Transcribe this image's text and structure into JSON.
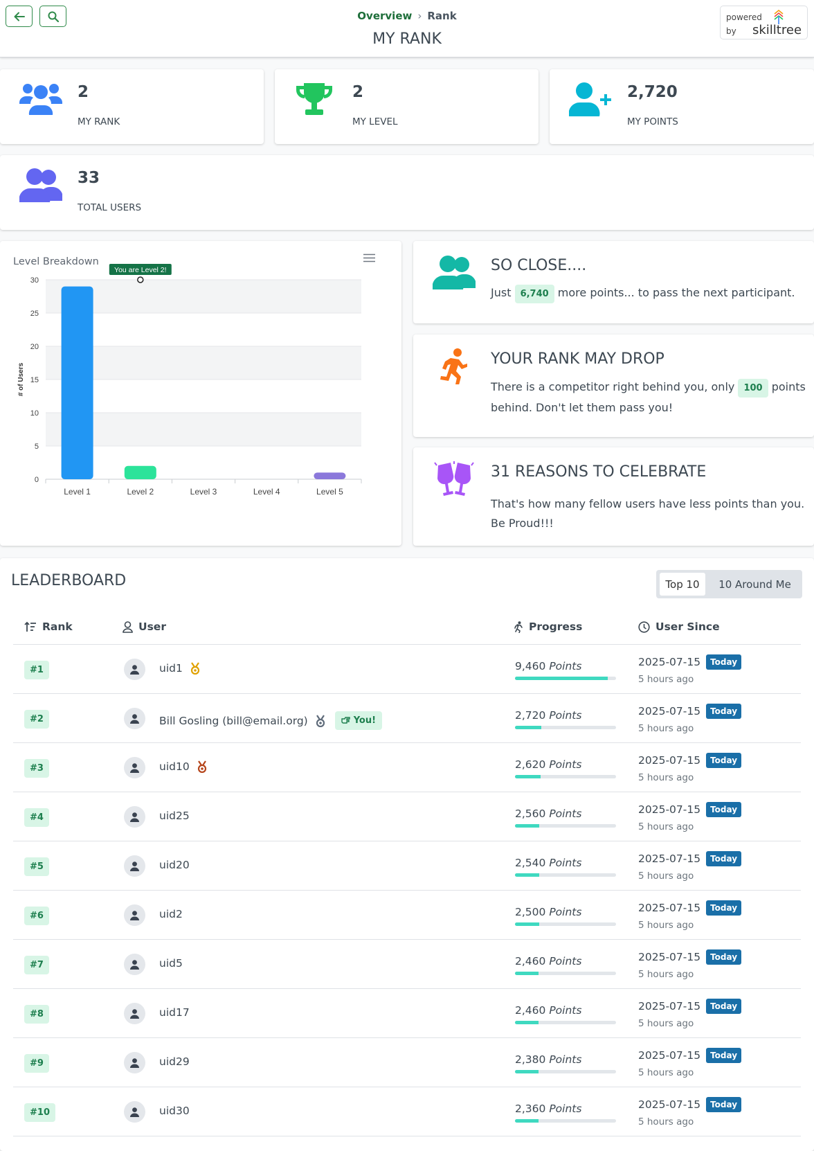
{
  "header": {
    "breadcrumb_overview": "Overview",
    "breadcrumb_rank": "Rank",
    "title": "MY RANK",
    "powered_by": "powered by",
    "brand": "skilltree"
  },
  "stats": [
    {
      "value": "2",
      "label": "MY RANK",
      "icon": "users-icon",
      "color": "#3b82f6"
    },
    {
      "value": "2",
      "label": "MY LEVEL",
      "icon": "trophy-icon",
      "color": "#22c55e"
    },
    {
      "value": "2,720",
      "label": "MY POINTS",
      "icon": "user-plus-icon",
      "color": "#06b6d4"
    },
    {
      "value": "33",
      "label": "TOTAL USERS",
      "icon": "user-friends-icon",
      "color": "#6366f1"
    }
  ],
  "chart_data": {
    "type": "bar",
    "title": "Level Breakdown",
    "ylabel": "# of Users",
    "categories": [
      "Level 1",
      "Level 2",
      "Level 3",
      "Level 4",
      "Level 5"
    ],
    "values": [
      29,
      2,
      0,
      0,
      1
    ],
    "colors": [
      "#2196f3",
      "#2ce39a",
      "#feb019",
      "#ff4560",
      "#8b78db"
    ],
    "ylim": [
      0,
      30
    ],
    "yticks": [
      "0",
      "5",
      "10",
      "15",
      "20",
      "25",
      "30"
    ],
    "annotation": "You are Level 2!",
    "annotation_category": "Level 2"
  },
  "cards": {
    "close": {
      "title": "SO CLOSE....",
      "pre": "Just",
      "highlight": "6,740",
      "post": "more points... to pass the next participant."
    },
    "drop": {
      "title": "YOUR RANK MAY DROP",
      "pre": "There is a competitor right behind you, only",
      "highlight": "100",
      "post": "points behind. Don't let them pass you!"
    },
    "celebrate": {
      "title": "31 REASONS TO CELEBRATE",
      "text": "That's how many fellow users have less points than you. Be Proud!!!"
    }
  },
  "leaderboard": {
    "title": "LEADERBOARD",
    "toggle_top": "Top 10",
    "toggle_around": "10 Around Me",
    "headers": {
      "rank": "Rank",
      "user": "User",
      "progress": "Progress",
      "since": "User Since"
    },
    "points_unit": "Points",
    "today_label": "Today",
    "you_label": "You!",
    "rows": [
      {
        "rank": "#1",
        "user": "uid1",
        "points": "9,460",
        "progress": 0.92,
        "date": "2025-07-15",
        "ago": "5 hours ago",
        "medal": "gold"
      },
      {
        "rank": "#2",
        "user": "Bill Gosling (bill@email.org)",
        "points": "2,720",
        "progress": 0.26,
        "date": "2025-07-15",
        "ago": "5 hours ago",
        "medal": "silver",
        "you": true
      },
      {
        "rank": "#3",
        "user": "uid10",
        "points": "2,620",
        "progress": 0.25,
        "date": "2025-07-15",
        "ago": "5 hours ago",
        "medal": "bronze"
      },
      {
        "rank": "#4",
        "user": "uid25",
        "points": "2,560",
        "progress": 0.24,
        "date": "2025-07-15",
        "ago": "5 hours ago"
      },
      {
        "rank": "#5",
        "user": "uid20",
        "points": "2,540",
        "progress": 0.24,
        "date": "2025-07-15",
        "ago": "5 hours ago"
      },
      {
        "rank": "#6",
        "user": "uid2",
        "points": "2,500",
        "progress": 0.24,
        "date": "2025-07-15",
        "ago": "5 hours ago"
      },
      {
        "rank": "#7",
        "user": "uid5",
        "points": "2,460",
        "progress": 0.23,
        "date": "2025-07-15",
        "ago": "5 hours ago"
      },
      {
        "rank": "#8",
        "user": "uid17",
        "points": "2,460",
        "progress": 0.23,
        "date": "2025-07-15",
        "ago": "5 hours ago"
      },
      {
        "rank": "#9",
        "user": "uid29",
        "points": "2,380",
        "progress": 0.23,
        "date": "2025-07-15",
        "ago": "5 hours ago"
      },
      {
        "rank": "#10",
        "user": "uid30",
        "points": "2,360",
        "progress": 0.23,
        "date": "2025-07-15",
        "ago": "5 hours ago"
      }
    ]
  }
}
